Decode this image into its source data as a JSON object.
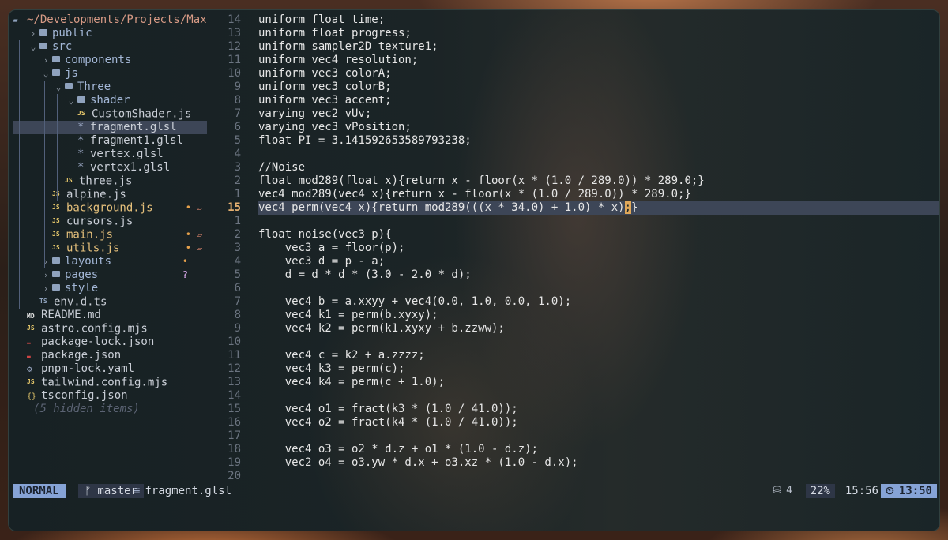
{
  "sidebar": {
    "root": "~/Developments/Projects/Max",
    "items": [
      {
        "label": "public",
        "kind": "folder",
        "arrow": "›"
      },
      {
        "label": "src",
        "kind": "folder",
        "arrow": "⌄"
      },
      {
        "label": "components",
        "kind": "folder",
        "arrow": "›"
      },
      {
        "label": "js",
        "kind": "folder",
        "arrow": "⌄"
      },
      {
        "label": "Three",
        "kind": "folder",
        "arrow": "⌄"
      },
      {
        "label": "shader",
        "kind": "folder",
        "arrow": "⌄"
      },
      {
        "label": "CustomShader.js",
        "kind": "js"
      },
      {
        "label": "fragment.glsl",
        "kind": "star",
        "selected": true
      },
      {
        "label": "fragment1.glsl",
        "kind": "star"
      },
      {
        "label": "vertex.glsl",
        "kind": "star"
      },
      {
        "label": "vertex1.glsl",
        "kind": "star"
      },
      {
        "label": "three.js",
        "kind": "js"
      },
      {
        "label": "alpine.js",
        "kind": "js"
      },
      {
        "label": "background.js",
        "kind": "js",
        "modified": true
      },
      {
        "label": "cursors.js",
        "kind": "js"
      },
      {
        "label": "main.js",
        "kind": "js",
        "modified": true
      },
      {
        "label": "utils.js",
        "kind": "js",
        "modified": true
      },
      {
        "label": "layouts",
        "kind": "folder",
        "arrow": "›",
        "dot": true
      },
      {
        "label": "pages",
        "kind": "folder",
        "arrow": "›",
        "untracked": true
      },
      {
        "label": "style",
        "kind": "folder",
        "arrow": "›"
      },
      {
        "label": "env.d.ts",
        "kind": "ts"
      },
      {
        "label": "README.md",
        "kind": "md"
      },
      {
        "label": "astro.config.mjs",
        "kind": "js"
      },
      {
        "label": "package-lock.json",
        "kind": "lock"
      },
      {
        "label": "package.json",
        "kind": "npm"
      },
      {
        "label": "pnpm-lock.yaml",
        "kind": "gear"
      },
      {
        "label": "tailwind.config.mjs",
        "kind": "js"
      },
      {
        "label": "tsconfig.json",
        "kind": "braces"
      }
    ],
    "hidden": "(5 hidden items)",
    "icon_labels": {
      "js": "JS",
      "ts": "TS",
      "md": "MD",
      "star": "*",
      "dot": "•",
      "mod": "▱",
      "q": "?"
    }
  },
  "editor": {
    "line_numbers": [
      "14",
      "13",
      "12",
      "11",
      "10",
      "9",
      "8",
      "7",
      "6",
      "5",
      "4",
      "3",
      "2",
      "1",
      "15",
      "1",
      "2",
      "3",
      "4",
      "5",
      "6",
      "7",
      "8",
      "9",
      "10",
      "11",
      "12",
      "13",
      "14",
      "15",
      "16",
      "17",
      "18",
      "19",
      "20"
    ],
    "lines": [
      "uniform float time;",
      "uniform float progress;",
      "uniform sampler2D texture1;",
      "uniform vec4 resolution;",
      "uniform vec3 colorA;",
      "uniform vec3 colorB;",
      "uniform vec3 accent;",
      "varying vec2 vUv;",
      "varying vec3 vPosition;",
      "float PI = 3.141592653589793238;",
      "",
      "//Noise",
      "float mod289(float x){return x - floor(x * (1.0 / 289.0)) * 289.0;}",
      "vec4 mod289(vec4 x){return x - floor(x * (1.0 / 289.0)) * 289.0;}",
      "vec4 perm(vec4 x){return mod289(((x * 34.0) + 1.0) * x)",
      "",
      "float noise(vec3 p){",
      "    vec3 a = floor(p);",
      "    vec3 d = p - a;",
      "    d = d * d * (3.0 - 2.0 * d);",
      "",
      "    vec4 b = a.xxyy + vec4(0.0, 1.0, 0.0, 1.0);",
      "    vec4 k1 = perm(b.xyxy);",
      "    vec4 k2 = perm(k1.xyxy + b.zzww);",
      "",
      "    vec4 c = k2 + a.zzzz;",
      "    vec4 k3 = perm(c);",
      "    vec4 k4 = perm(c + 1.0);",
      "",
      "    vec4 o1 = fract(k3 * (1.0 / 41.0));",
      "    vec4 o2 = fract(k4 * (1.0 / 41.0));",
      "",
      "    vec4 o3 = o2 * d.z + o1 * (1.0 - d.z);",
      "    vec2 o4 = o3.yw * d.x + o3.xz * (1.0 - d.x);"
    ],
    "cursor_char": ";",
    "cursor_tail": "}",
    "current_line_index": 14
  },
  "statusbar": {
    "mode": "NORMAL",
    "branch": "master",
    "branch_icon": "ᚠ",
    "file_icon": "≡",
    "file": "fragment.glsl",
    "buffers_icon": "⛁",
    "buffers": "4",
    "percent": "22%",
    "position": "15:56",
    "clock_icon": "⏲",
    "time": "13:50"
  }
}
